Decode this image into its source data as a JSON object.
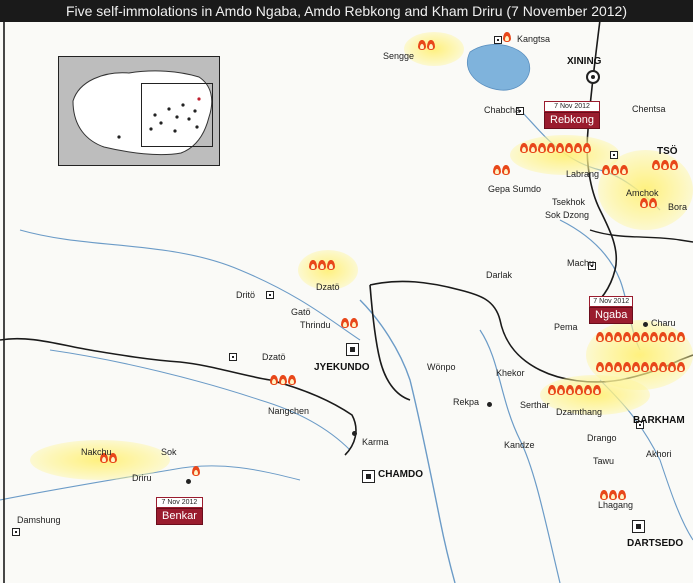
{
  "title": "Five self-immolations in Amdo Ngaba, Amdo Rebkong and Kham Driru (7 November 2012)",
  "colors": {
    "river": "#6b9bc7",
    "lake": "#7fb3dc",
    "border": "#1a1a1a",
    "callout": "#9a1c2e",
    "flame": "#e8471a",
    "glow": "#fff08a"
  },
  "places": {
    "sengge": "Sengge",
    "kangtsa": "Kangtsa",
    "xining": "XINING",
    "chabcha": "Chabcha",
    "chentsa": "Chentsa",
    "tso": "TSÖ",
    "labrang": "Labrang",
    "amchok": "Amchok",
    "bora": "Bora",
    "gepa_sumdo": "Gepa Sumdo",
    "tsekhok": "Tsekhok",
    "sok_dzong": "Sok Dzong",
    "machu": "Machu",
    "darlak": "Darlak",
    "pema": "Pema",
    "charu": "Charu",
    "drito": "Dritö",
    "dzato_n": "Dzatö",
    "gato": "Gatö",
    "thrindu": "Thrindu",
    "dzato_s": "Dzatö",
    "jyekundo": "JYEKUNDO",
    "wonpo": "Wönpo",
    "khekor": "Khekor",
    "rekpa": "Rekpa",
    "serthar": "Serthar",
    "dzamthang": "Dzamthang",
    "barkham": "BARKHAM",
    "nangchen": "Nangchen",
    "karma": "Karma",
    "kandze": "Kandze",
    "drango": "Drango",
    "akhori": "Akhori",
    "tawu": "Tawu",
    "sok": "Sok",
    "nakchu": "Nakchu",
    "driru": "Driru",
    "chamdo": "CHAMDO",
    "lhagang": "Lhagang",
    "dartsedo": "DARTSEDO",
    "damshung": "Damshung"
  },
  "callouts": {
    "rebkong": {
      "date": "7 Nov 2012",
      "place": "Rebkong"
    },
    "ngaba": {
      "date": "7 Nov 2012",
      "place": "Ngaba"
    },
    "benkar": {
      "date": "7 Nov 2012",
      "place": "Benkar"
    }
  },
  "icons": {
    "flame": "flame-icon",
    "town": "town-square-icon",
    "city": "city-square-icon",
    "capital": "capital-circle-icon"
  }
}
